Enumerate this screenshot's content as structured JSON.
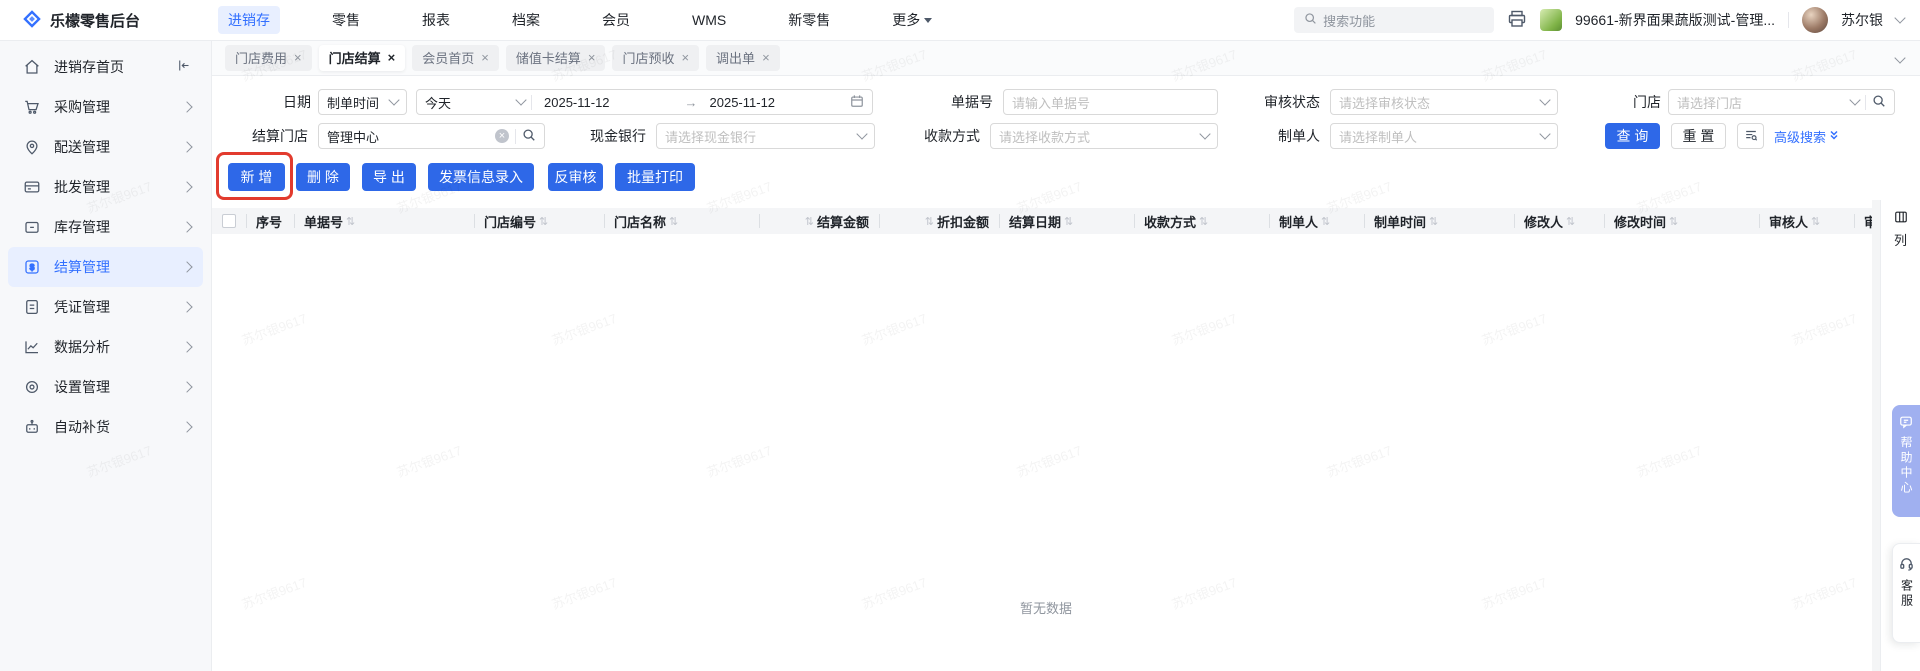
{
  "navbar": {
    "logo_text": "乐檬零售后台",
    "menu": [
      {
        "label": "进销存",
        "active": true
      },
      {
        "label": "零售",
        "active": false
      },
      {
        "label": "报表",
        "active": false
      },
      {
        "label": "档案",
        "active": false
      },
      {
        "label": "会员",
        "active": false
      },
      {
        "label": "WMS",
        "active": false
      },
      {
        "label": "新零售",
        "active": false
      },
      {
        "label": "更多",
        "active": false
      }
    ],
    "search_placeholder": "搜索功能",
    "store_label": "99661-新界面果蔬版测试-管理...",
    "username": "苏尔银"
  },
  "sidebar": {
    "items": [
      {
        "label": "进销存首页",
        "icon": "home-icon",
        "active": false
      },
      {
        "label": "采购管理",
        "icon": "cart-icon",
        "active": false
      },
      {
        "label": "配送管理",
        "icon": "delivery-icon",
        "active": false
      },
      {
        "label": "批发管理",
        "icon": "wholesale-icon",
        "active": false
      },
      {
        "label": "库存管理",
        "icon": "inventory-icon",
        "active": false
      },
      {
        "label": "结算管理",
        "icon": "settlement-icon",
        "active": true
      },
      {
        "label": "凭证管理",
        "icon": "voucher-icon",
        "active": false
      },
      {
        "label": "数据分析",
        "icon": "analytics-icon",
        "active": false
      },
      {
        "label": "设置管理",
        "icon": "settings-icon",
        "active": false
      },
      {
        "label": "自动补货",
        "icon": "replenish-icon",
        "active": false
      }
    ]
  },
  "tabs": [
    {
      "label": "门店费用",
      "active": false
    },
    {
      "label": "门店结算",
      "active": true
    },
    {
      "label": "会员首页",
      "active": false
    },
    {
      "label": "储值卡结算",
      "active": false
    },
    {
      "label": "门店预收",
      "active": false
    },
    {
      "label": "调出单",
      "active": false
    }
  ],
  "filters": {
    "date": {
      "label": "日期",
      "type_value": "制单时间",
      "preset_value": "今天",
      "from": "2025-11-12",
      "to": "2025-11-12"
    },
    "order_no": {
      "label": "单据号",
      "placeholder": "请输入单据号"
    },
    "audit_status": {
      "label": "审核状态",
      "placeholder": "请选择审核状态"
    },
    "store": {
      "label": "门店",
      "placeholder": "请选择门店"
    },
    "settle_store": {
      "label": "结算门店",
      "value": "管理中心"
    },
    "cash_bank": {
      "label": "现金银行",
      "placeholder": "请选择现金银行"
    },
    "pay_method": {
      "label": "收款方式",
      "placeholder": "请选择收款方式"
    },
    "maker": {
      "label": "制单人",
      "placeholder": "请选择制单人"
    },
    "query_label": "查 询",
    "reset_label": "重 置",
    "advanced_label": "高级搜索"
  },
  "actions": {
    "add": "新 增",
    "remove": "删 除",
    "export": "导 出",
    "invoice_entry": "发票信息录入",
    "unaudit": "反审核",
    "batch_print": "批量打印"
  },
  "table": {
    "columns": [
      {
        "label": "序号",
        "sort": false
      },
      {
        "label": "单据号",
        "sort": true
      },
      {
        "label": "门店编号",
        "sort": true
      },
      {
        "label": "门店名称",
        "sort": true
      },
      {
        "label": "结算金额",
        "sort": true
      },
      {
        "label": "折扣金额",
        "sort": true
      },
      {
        "label": "结算日期",
        "sort": true
      },
      {
        "label": "收款方式",
        "sort": true
      },
      {
        "label": "制单人",
        "sort": true
      },
      {
        "label": "制单时间",
        "sort": true
      },
      {
        "label": "修改人",
        "sort": true
      },
      {
        "label": "修改时间",
        "sort": true
      },
      {
        "label": "审核人",
        "sort": true
      },
      {
        "label": "审",
        "sort": false
      }
    ],
    "rows": [],
    "empty_text": "暂无数据",
    "column_config_label": "列"
  },
  "right_rail": {
    "help_center": "帮助中心",
    "customer_service": "客服"
  },
  "watermark": {
    "text": "苏尔银9617"
  },
  "icons": {
    "close": "×",
    "sort": "⇅",
    "arrow_right": "→"
  },
  "colors": {
    "accent_blue": "#2E68E8",
    "link_blue": "#3370FF",
    "active_bg": "#E8EFFF",
    "annotation_red": "#E23B2E"
  }
}
